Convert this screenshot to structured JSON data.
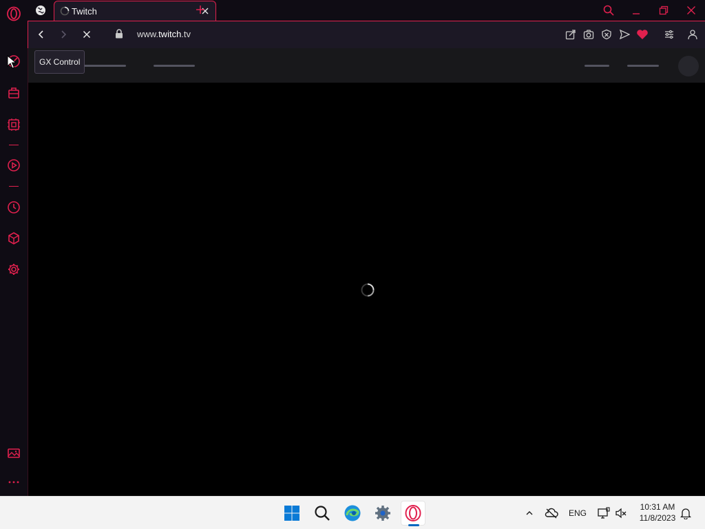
{
  "browser": {
    "tab": {
      "title": "Twitch"
    },
    "address": {
      "domain_prefix": "www.",
      "domain_main": "twitch",
      "domain_suffix": ".tv"
    },
    "accent_color": "#e1204e"
  },
  "sidebar": {
    "tooltip": "GX Control",
    "items": [
      {
        "icon": "opera-logo-icon"
      },
      {
        "icon": "gx-control-icon"
      },
      {
        "icon": "twitch-icon"
      },
      {
        "icon": "gx-corner-icon"
      },
      {
        "icon": "player-icon"
      },
      {
        "icon": "history-icon"
      },
      {
        "icon": "extensions-icon"
      },
      {
        "icon": "settings-icon"
      },
      {
        "icon": "gallery-icon"
      },
      {
        "icon": "more-icon"
      }
    ]
  },
  "page": {
    "state": "loading"
  },
  "taskbar": {
    "apps": [
      "start-icon",
      "search-icon",
      "edge-icon",
      "settings-icon",
      "opera-gx-icon"
    ],
    "tray": {
      "language": "ENG"
    },
    "clock": {
      "time": "10:31 AM",
      "date": "11/8/2023"
    }
  }
}
